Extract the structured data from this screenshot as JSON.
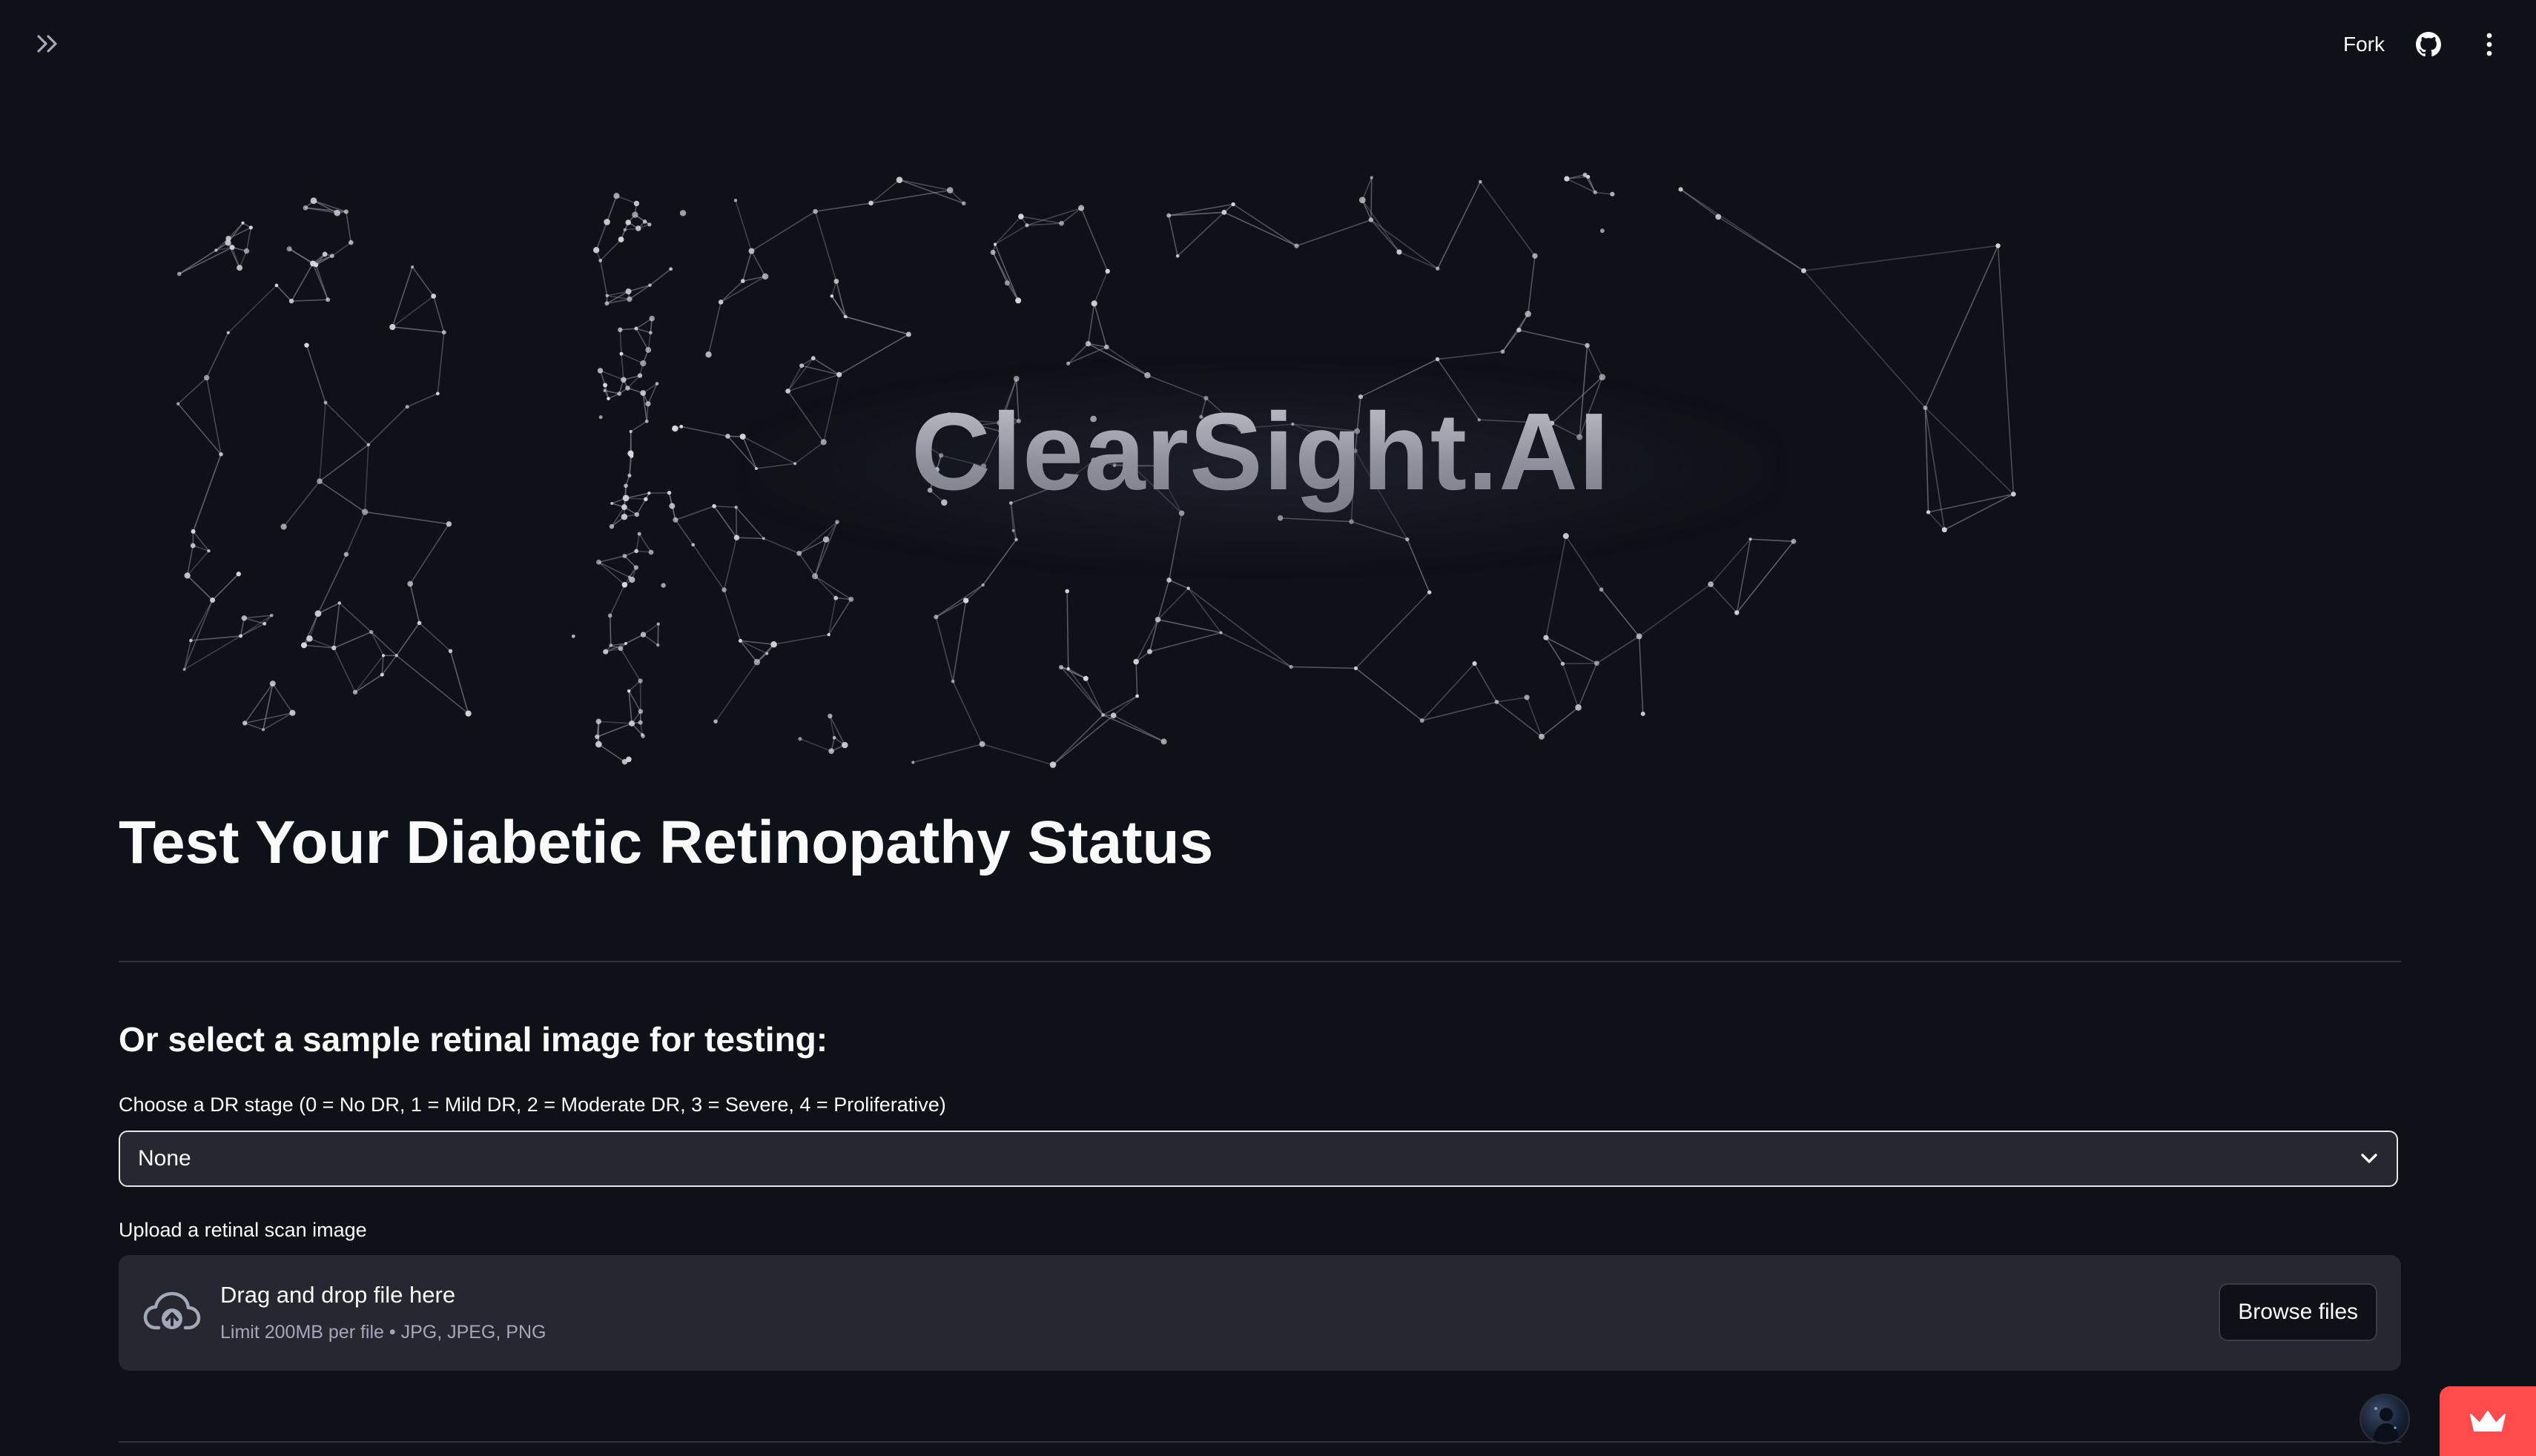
{
  "header": {
    "fork_label": "Fork",
    "sidebar_toggle_icon": "double-chevron-right-icon",
    "github_icon": "github-icon",
    "menu_icon": "kebab-menu-icon"
  },
  "hero": {
    "title": "ClearSight.AI",
    "background": "network-constellation-graphic"
  },
  "main": {
    "page_title": "Test Your Diabetic Retinopathy Status",
    "sample_section_heading": "Or select a sample retinal image for testing:",
    "stage_select": {
      "label": "Choose a DR stage (0 = No DR, 1 = Mild DR, 2 = Moderate DR, 3 = Severe, 4 = Proliferative)",
      "selected_value": "None"
    },
    "uploader": {
      "label": "Upload a retinal scan image",
      "drop_text": "Drag and drop file here",
      "limit_text": "Limit 200MB per file • JPG, JPEG, PNG",
      "browse_button": "Browse files"
    }
  },
  "colors": {
    "background": "#0e1117",
    "surface": "#262730",
    "text": "#fafafa",
    "muted_text": "#a3a8b8",
    "accent": "#ff4b4b"
  }
}
